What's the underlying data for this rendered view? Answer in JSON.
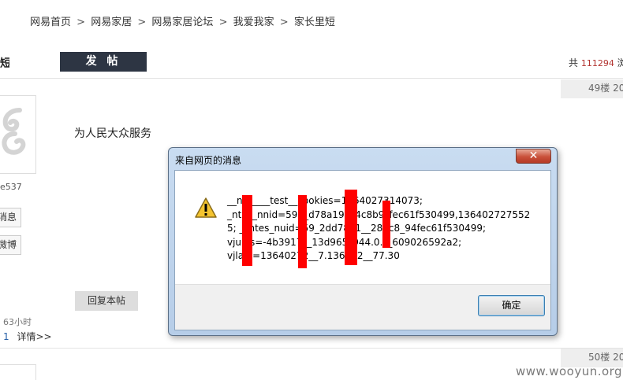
{
  "breadcrumb": {
    "items": [
      "网易首页",
      "网易家居",
      "网易家居论坛",
      "我爱我家",
      "家长里短"
    ],
    "separator": ">"
  },
  "header": {
    "title_fragment": "短",
    "post_button": "发 帖",
    "stats_prefix": "共",
    "stats_count": "111294",
    "stats_suffix": "浏"
  },
  "posts": [
    {
      "floor": "49楼",
      "floor_extra": "20",
      "username_fragment": "e537",
      "message_button": "消息",
      "weibo_button": "微博",
      "time_ago": "63小时",
      "detail_count": "1",
      "detail_link": "详情>>",
      "content": "为人民大众服务",
      "reply_button": "回复本帖"
    },
    {
      "floor": "50楼",
      "floor_extra": "20"
    }
  ],
  "dialog": {
    "title": "来自网页的消息",
    "close_glyph": "✕",
    "message_lines": [
      "__nt_____test__cookies=1364027314073;",
      "_ntes_nnid=593_d78a195_4c8b9_fec61f530499,136402727552",
      "5; __ntes_nuid=59_2dd78a1__284c8_94fec61f530499;",
      "vjuids=-4b3917__13d965_944.0.__609026592a2;",
      "vjlast=13640272__7.136402__77.30"
    ],
    "ok_button": "确定"
  },
  "watermark": "www.wooyun.org",
  "colors": {
    "post_button_bg": "#2d3543",
    "stats_number": "#b2332f",
    "redaction": "#ff0000",
    "close_button": "#c9503a"
  }
}
